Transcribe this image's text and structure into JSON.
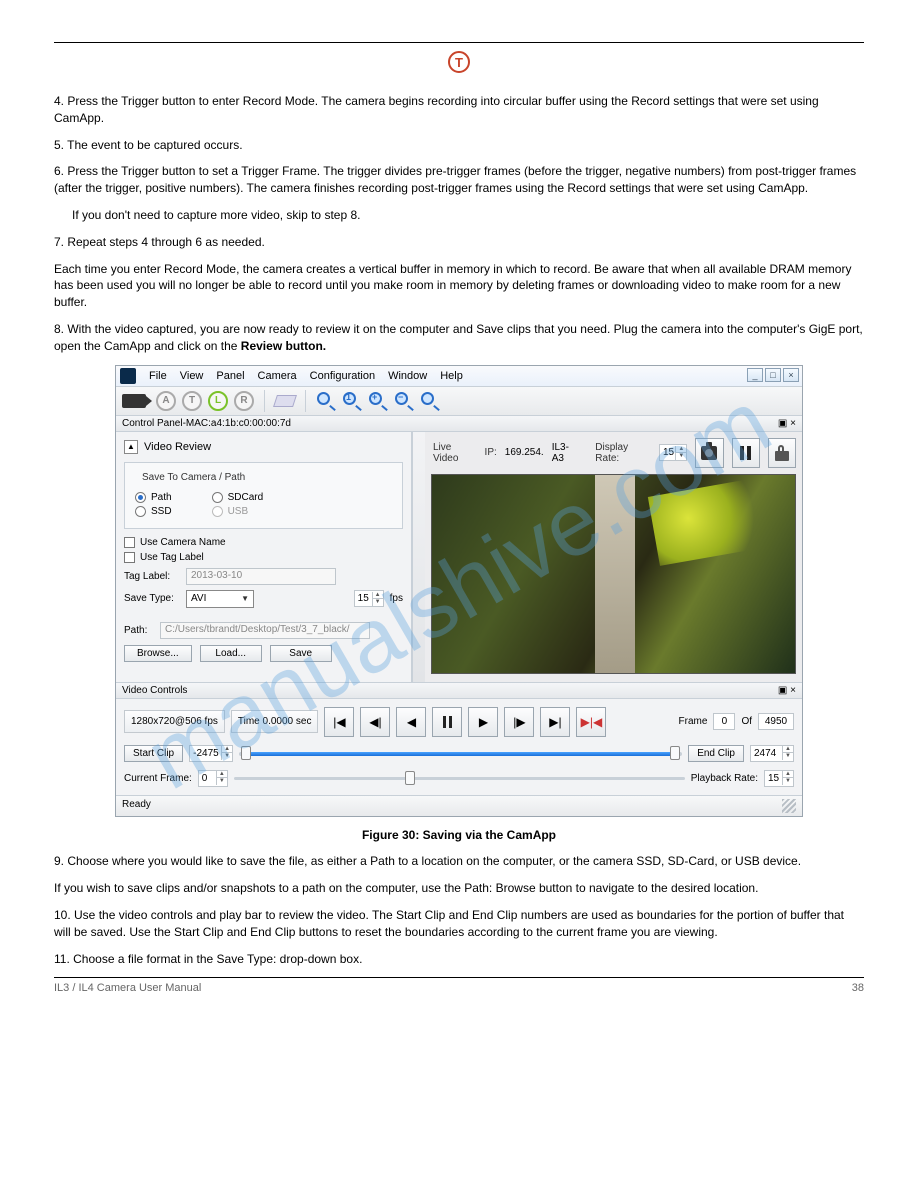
{
  "doc": {
    "step4": "4.  Press the Trigger button         to enter Record Mode. The camera begins recording into circular buffer using the Record settings that were set using CamApp.",
    "step5": "5.  The event to be captured occurs.",
    "step6a": "6.  Press the Trigger button to set a Trigger Frame. The trigger divides pre-trigger frames (before the trigger, negative numbers) from post-trigger frames (after the trigger, positive numbers). The camera finishes recording post-trigger frames using the Record settings that were set using CamApp.",
    "step6b": "If you don't need to capture more video, skip to step 8.",
    "step7a": "7.  Repeat steps 4 through 6 as needed.",
    "step7b": "        Each time you enter Record Mode, the camera creates a vertical buffer in memory in which to record. Be aware that when all available DRAM memory has been used you will no longer be able to record until you make room in memory by deleting frames or downloading video to make room for a new buffer.",
    "step8a": "8.  With the video captured, you are now ready to review it on the computer and Save clips that you need. Plug the camera into the computer's GigE port, open the CamApp and click on the ",
    "step8b": "Review button.",
    "figure_caption": "Figure 30: Saving via the CamApp",
    "step9a": "9.  Choose where you would like to save the file, as either a Path to a location on the computer, or the camera SSD, SD-Card, or USB device.",
    "step9b": "           If you wish to save clips and/or snapshots to a path on the computer, use the Path: Browse button to navigate to the desired location.",
    "step10": "10. Use the video controls and play bar to review the video. The Start Clip and End Clip numbers are used as boundaries for the portion of buffer that will be saved. Use the Start Clip and End Clip buttons to reset the boundaries according to the current frame you are viewing.",
    "step11": "11. Choose a file format in the Save Type: drop-down box.",
    "footer_left": "IL3 / IL4 Camera User Manual",
    "footer_right": "38"
  },
  "app": {
    "menus": [
      "File",
      "View",
      "Panel",
      "Camera",
      "Configuration",
      "Window",
      "Help"
    ],
    "control_panel_title": "Control Panel-MAC:a4:1b:c0:00:00:7d",
    "video_review": "Video Review",
    "save_group": "Save To Camera / Path",
    "radios": {
      "path": "Path",
      "sdcard": "SDCard",
      "ssd": "SSD",
      "usb": "USB"
    },
    "use_camera_name": "Use Camera Name",
    "use_tag_label": "Use Tag Label",
    "tag_label_lbl": "Tag Label:",
    "tag_label_val": "2013-03-10",
    "save_type_lbl": "Save Type:",
    "save_type_val": "AVI",
    "fps_val": "15",
    "fps_suffix": "fps",
    "path_lbl": "Path:",
    "path_val": "C:/Users/tbrandt/Desktop/Test/3_7_black/",
    "browse_btn": "Browse...",
    "load_btn": "Load...",
    "save_btn": "Save",
    "live_video": "Live Video",
    "ip_lbl": "IP:",
    "ip_val": "169.254.",
    "camera_id": "IL3-A3",
    "display_rate_lbl": "Display Rate:",
    "display_rate_val": "15",
    "video_controls": "Video Controls",
    "res_info": "1280x720@506 fps",
    "time_info": "Time 0.0000 sec",
    "frame_lbl": "Frame",
    "frame_val": "0",
    "of_lbl": "Of",
    "total_frames": "4950",
    "start_clip": "Start Clip",
    "start_clip_val": "-2475",
    "end_clip": "End Clip",
    "end_clip_val": "2474",
    "current_frame_lbl": "Current Frame:",
    "current_frame_val": "0",
    "playback_rate_lbl": "Playback Rate:",
    "playback_rate_val": "15",
    "status": "Ready"
  }
}
